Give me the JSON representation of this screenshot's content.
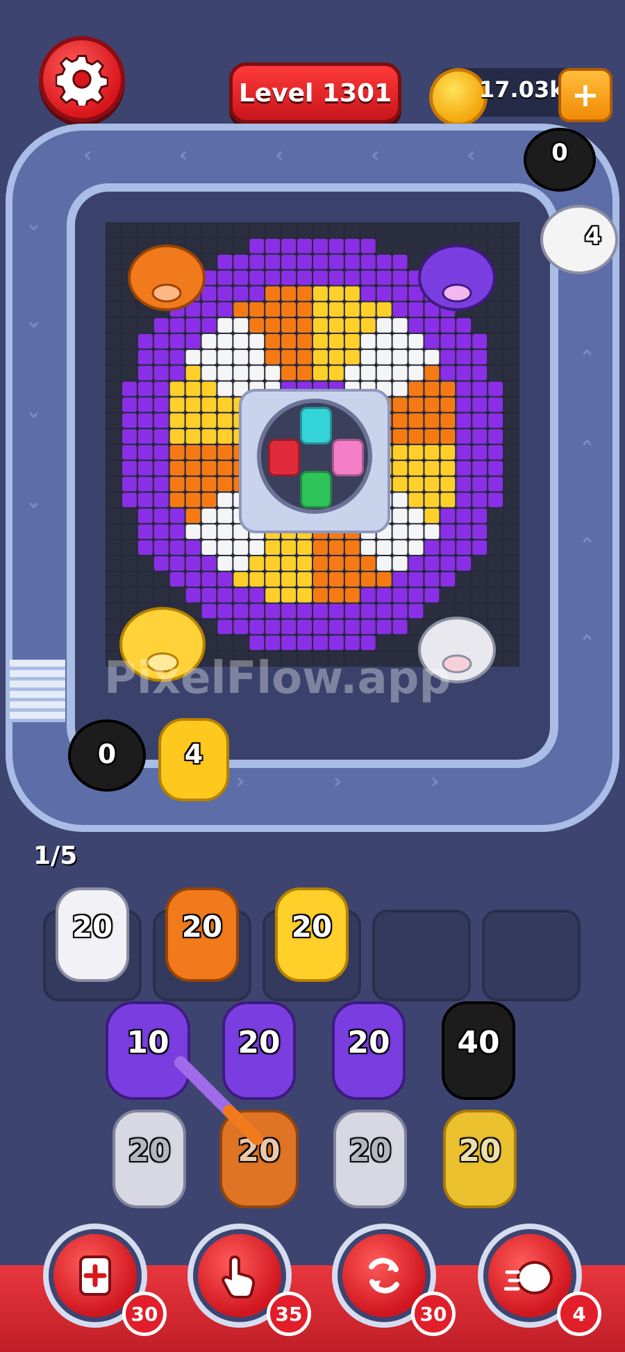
{
  "header": {
    "settings_icon": "gear-icon",
    "level_label": "Level 1301",
    "coins_value": "17.03k",
    "coin_icon": "coin-icon",
    "add_coins_label": "+"
  },
  "conveyor": {
    "top_right_pig": {
      "count": "0",
      "color": "#1c1c1c"
    },
    "top_right_pig_2": {
      "count": "4",
      "color": "#f4f4f4"
    },
    "bottom_left_pig": {
      "count": "0",
      "color": "#1c1c1c"
    },
    "bottom_left_pig_2": {
      "count": "4",
      "color": "#ffc81e"
    }
  },
  "board": {
    "corner_pigs": [
      {
        "name": "orange-pig",
        "color": "#f07a1c"
      },
      {
        "name": "purple-pig",
        "color": "#7a3ee0"
      },
      {
        "name": "yellow-pig",
        "color": "#ffd23a"
      },
      {
        "name": "white-pig",
        "color": "#e8e8ee"
      }
    ],
    "watermark": "PixelFlow.app"
  },
  "queue_progress": "1/5",
  "slots": [
    {
      "count": "20",
      "color": "#f2f2f6"
    },
    {
      "count": "20",
      "color": "#f07a1c"
    },
    {
      "count": "20",
      "color": "#ffcf2a"
    },
    {
      "count": "",
      "color": ""
    },
    {
      "count": "",
      "color": ""
    }
  ],
  "queue": {
    "row1": [
      {
        "count": "10",
        "color": "#7a3ee0"
      },
      {
        "count": "20",
        "color": "#7a3ee0"
      },
      {
        "count": "20",
        "color": "#7a3ee0"
      },
      {
        "count": "40",
        "color": "#1c1c1c"
      }
    ],
    "row2": [
      {
        "count": "20",
        "color": "#f2f2f6"
      },
      {
        "count": "20",
        "color": "#f07a1c"
      },
      {
        "count": "20",
        "color": "#f2f2f6"
      },
      {
        "count": "20",
        "color": "#ffcf2a"
      }
    ]
  },
  "powerups": [
    {
      "name": "add-slot",
      "icon": "card-plus-icon",
      "count": "30"
    },
    {
      "name": "hand",
      "icon": "hand-pointer-icon",
      "count": "35"
    },
    {
      "name": "shuffle",
      "icon": "refresh-icon",
      "count": "30"
    },
    {
      "name": "pig-dash",
      "icon": "pig-dash-icon",
      "count": "4"
    }
  ]
}
